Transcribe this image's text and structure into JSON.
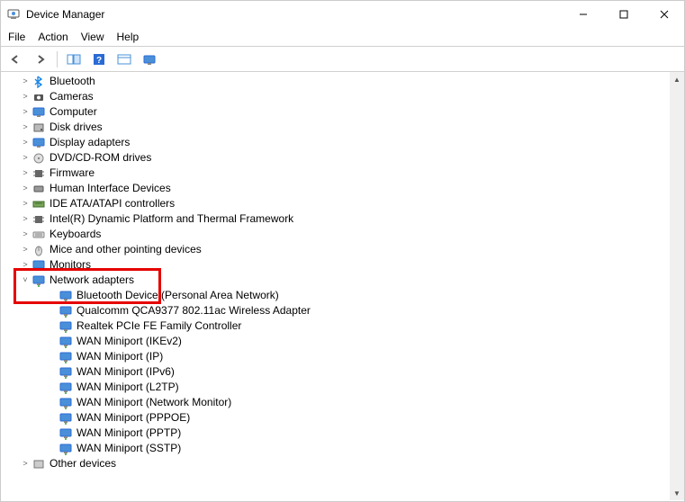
{
  "window": {
    "title": "Device Manager"
  },
  "menubar": {
    "file": "File",
    "action": "Action",
    "view": "View",
    "help": "Help"
  },
  "tree": {
    "categories": [
      {
        "id": "bluetooth",
        "label": "Bluetooth",
        "icon": "bluetooth",
        "expanded": false
      },
      {
        "id": "cameras",
        "label": "Cameras",
        "icon": "camera",
        "expanded": false
      },
      {
        "id": "computer",
        "label": "Computer",
        "icon": "monitor",
        "expanded": false
      },
      {
        "id": "disk",
        "label": "Disk drives",
        "icon": "disk",
        "expanded": false
      },
      {
        "id": "display",
        "label": "Display adapters",
        "icon": "monitor",
        "expanded": false
      },
      {
        "id": "dvd",
        "label": "DVD/CD-ROM drives",
        "icon": "disc",
        "expanded": false
      },
      {
        "id": "firmware",
        "label": "Firmware",
        "icon": "chip",
        "expanded": false
      },
      {
        "id": "hid",
        "label": "Human Interface Devices",
        "icon": "hid",
        "expanded": false
      },
      {
        "id": "ide",
        "label": "IDE ATA/ATAPI controllers",
        "icon": "ide",
        "expanded": false
      },
      {
        "id": "intel",
        "label": "Intel(R) Dynamic Platform and Thermal Framework",
        "icon": "chip",
        "expanded": false
      },
      {
        "id": "keyboards",
        "label": "Keyboards",
        "icon": "keyboard",
        "expanded": false
      },
      {
        "id": "mice",
        "label": "Mice and other pointing devices",
        "icon": "mouse",
        "expanded": false
      },
      {
        "id": "monitors",
        "label": "Monitors",
        "icon": "monitor",
        "expanded": false
      },
      {
        "id": "network",
        "label": "Network adapters",
        "icon": "network",
        "expanded": true,
        "children": [
          {
            "label": "Bluetooth Device (Personal Area Network)"
          },
          {
            "label": "Qualcomm QCA9377 802.11ac Wireless Adapter"
          },
          {
            "label": "Realtek PCIe FE Family Controller"
          },
          {
            "label": "WAN Miniport (IKEv2)"
          },
          {
            "label": "WAN Miniport (IP)"
          },
          {
            "label": "WAN Miniport (IPv6)"
          },
          {
            "label": "WAN Miniport (L2TP)"
          },
          {
            "label": "WAN Miniport (Network Monitor)"
          },
          {
            "label": "WAN Miniport (PPPOE)"
          },
          {
            "label": "WAN Miniport (PPTP)"
          },
          {
            "label": "WAN Miniport (SSTP)"
          }
        ]
      },
      {
        "id": "other",
        "label": "Other devices",
        "icon": "other",
        "expanded": false
      }
    ]
  }
}
